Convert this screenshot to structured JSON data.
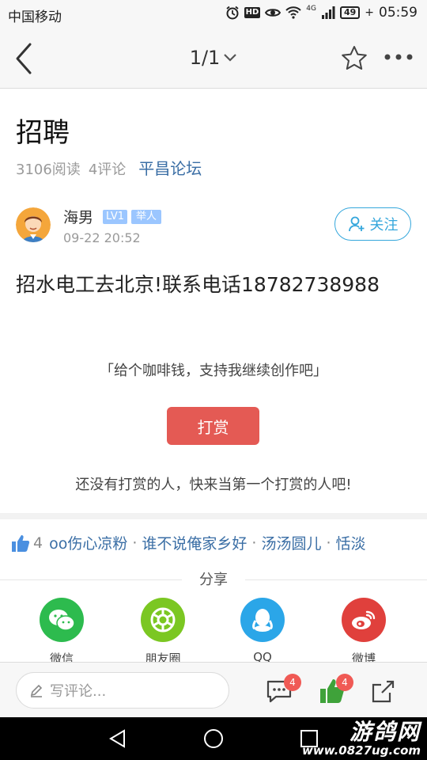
{
  "status_bar": {
    "carrier": "中国移动",
    "network": "4G",
    "battery": "49",
    "time": "05:59"
  },
  "navbar": {
    "page_indicator": "1/1"
  },
  "post": {
    "title": "招聘",
    "reads": "3106阅读",
    "comments": "4评论",
    "forum": "平昌论坛",
    "author": "海男",
    "level": "LV1",
    "role": "举人",
    "time": "09-22 20:52",
    "follow_label": "关注",
    "content": "招水电工去北京!联系电话18782738988"
  },
  "tip": {
    "prompt": "「给个咖啡钱，支持我继续创作吧」",
    "button": "打赏",
    "none_yet": "还没有打赏的人，快来当第一个打赏的人吧!"
  },
  "likes": {
    "count": "4",
    "users": [
      "oo伤心凉粉",
      "谁不说俺家乡好",
      "汤汤圆儿",
      "恬淡"
    ]
  },
  "share": {
    "title": "分享",
    "items": [
      {
        "label": "微信",
        "icon": "wechat-icon",
        "color": "#2dbb4e"
      },
      {
        "label": "朋友圈",
        "icon": "moments-icon",
        "color": "#7bc722"
      },
      {
        "label": "QQ",
        "icon": "qq-icon",
        "color": "#2ba6e8"
      },
      {
        "label": "微博",
        "icon": "weibo-icon",
        "color": "#e0403c"
      }
    ]
  },
  "bottom_bar": {
    "comment_placeholder": "写评论...",
    "comment_badge": "4",
    "like_badge": "4"
  },
  "watermark": {
    "name": "游鸽网",
    "url": "www.0827ug.com"
  },
  "colors": {
    "accent_blue": "#35a7dc",
    "forum_link": "#3a6ea5",
    "tip_button": "#e45a54",
    "badge_red": "#f05a55"
  }
}
